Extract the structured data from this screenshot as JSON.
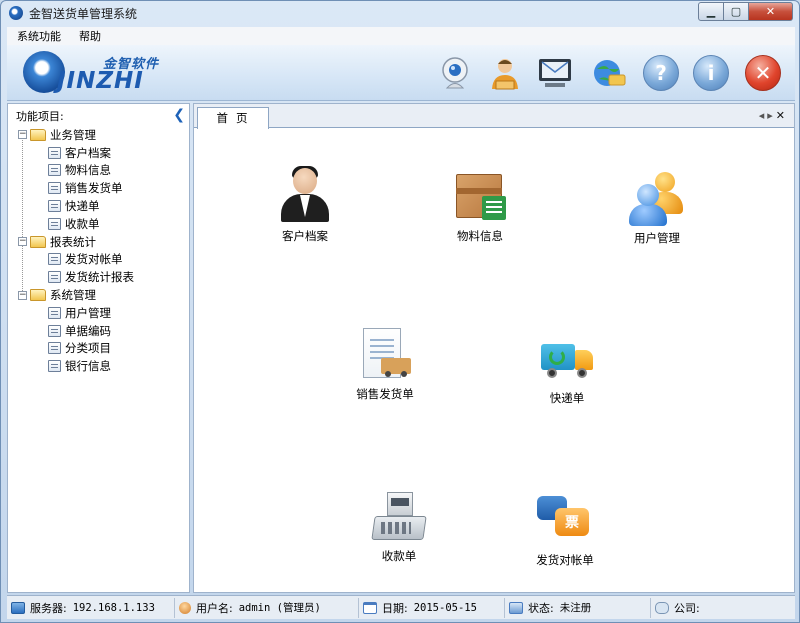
{
  "window": {
    "title": "金智送货单管理系统"
  },
  "menu": [
    {
      "label": "系统功能"
    },
    {
      "label": "帮助"
    }
  ],
  "logo": {
    "cn": "金智软件",
    "en": "JINZHI"
  },
  "toolbar": [
    {
      "name": "webcam-icon"
    },
    {
      "name": "user-support-icon"
    },
    {
      "name": "mail-icon"
    },
    {
      "name": "network-icon"
    },
    {
      "name": "help-icon",
      "glyph": "?"
    },
    {
      "name": "info-icon",
      "glyph": "i"
    },
    {
      "name": "exit-icon",
      "glyph": "✕"
    }
  ],
  "sidebar": {
    "header": "功能项目:",
    "groups": [
      {
        "label": "业务管理",
        "items": [
          "客户档案",
          "物料信息",
          "销售发货单",
          "快递单",
          "收款单"
        ]
      },
      {
        "label": "报表统计",
        "items": [
          "发货对帐单",
          "发货统计报表"
        ]
      },
      {
        "label": "系统管理",
        "items": [
          "用户管理",
          "单据编码",
          "分类项目",
          "银行信息"
        ]
      }
    ]
  },
  "tabs": [
    {
      "label": "首页"
    }
  ],
  "shortcuts": [
    {
      "label": "客户档案"
    },
    {
      "label": "物料信息"
    },
    {
      "label": "用户管理"
    },
    {
      "label": "销售发货单"
    },
    {
      "label": "快递单"
    },
    {
      "label": "收款单"
    },
    {
      "label": "发货对帐单"
    }
  ],
  "status": {
    "server_label": "服务器:",
    "server_value": "192.168.1.133",
    "user_label": "用户名:",
    "user_value": "admin (管理员)",
    "date_label": "日期:",
    "date_value": "2015-05-15",
    "state_label": "状态:",
    "state_value": "未注册",
    "company_label": "公司:",
    "company_value": ""
  }
}
